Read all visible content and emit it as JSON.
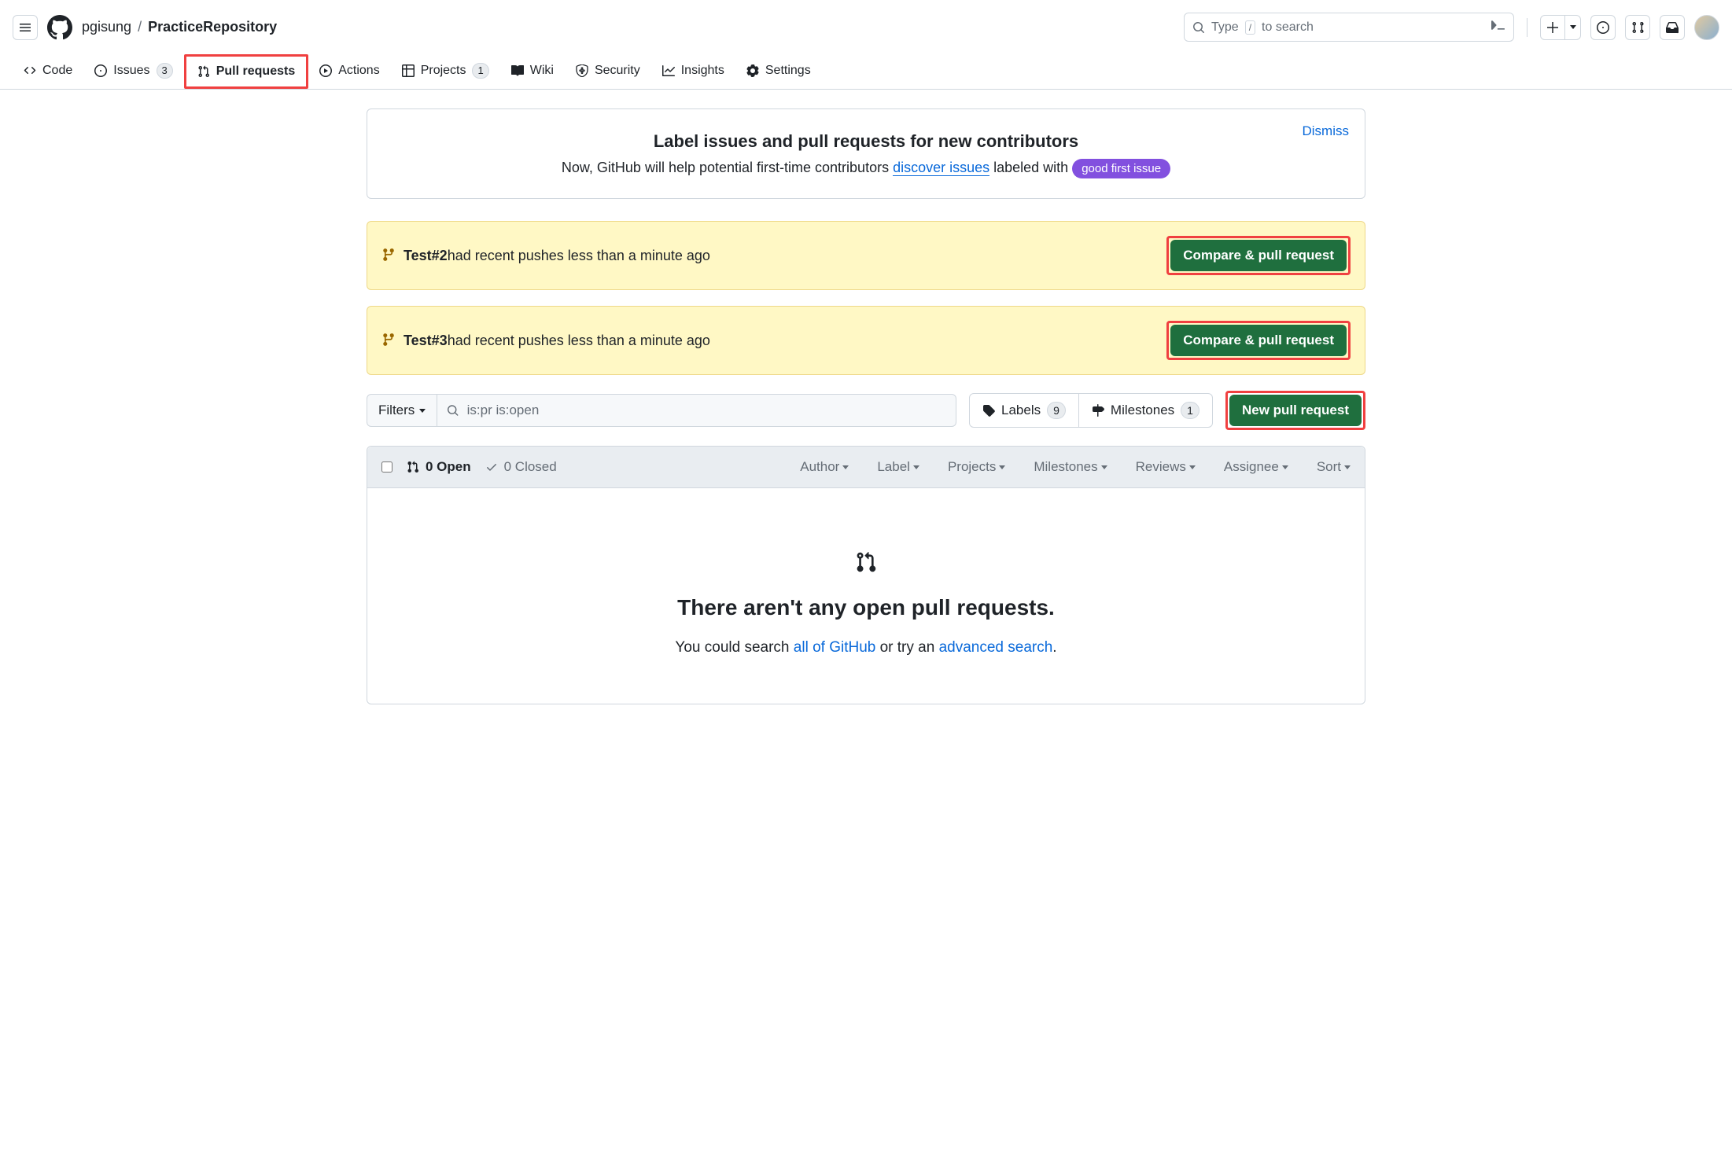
{
  "header": {
    "owner": "pgisung",
    "repo": "PracticeRepository",
    "search_placeholder_pre": "Type",
    "search_placeholder_post": "to search",
    "slash_key": "/"
  },
  "reponav": {
    "code": "Code",
    "issues": "Issues",
    "issues_count": "3",
    "pulls": "Pull requests",
    "actions": "Actions",
    "projects": "Projects",
    "projects_count": "1",
    "wiki": "Wiki",
    "security": "Security",
    "insights": "Insights",
    "settings": "Settings"
  },
  "infobox": {
    "dismiss": "Dismiss",
    "title": "Label issues and pull requests for new contributors",
    "body_pre": "Now, GitHub will help potential first-time contributors ",
    "discover": "discover issues",
    "body_mid": " labeled with ",
    "pill": "good first issue"
  },
  "banners": [
    {
      "branch": "Test#2",
      "msg": " had recent pushes less than a minute ago",
      "button": "Compare & pull request"
    },
    {
      "branch": "Test#3",
      "msg": " had recent pushes less than a minute ago",
      "button": "Compare & pull request"
    }
  ],
  "filters": {
    "button": "Filters",
    "query": "is:pr is:open",
    "labels": "Labels",
    "labels_count": "9",
    "milestones": "Milestones",
    "milestones_count": "1",
    "new_pr": "New pull request"
  },
  "table": {
    "open": "0 Open",
    "closed": "0 Closed",
    "dd_author": "Author",
    "dd_label": "Label",
    "dd_projects": "Projects",
    "dd_milestones": "Milestones",
    "dd_reviews": "Reviews",
    "dd_assignee": "Assignee",
    "dd_sort": "Sort",
    "empty_title": "There aren't any open pull requests.",
    "empty_pre": "You could search ",
    "empty_link1": "all of GitHub",
    "empty_mid": " or try an ",
    "empty_link2": "advanced search",
    "empty_post": "."
  }
}
